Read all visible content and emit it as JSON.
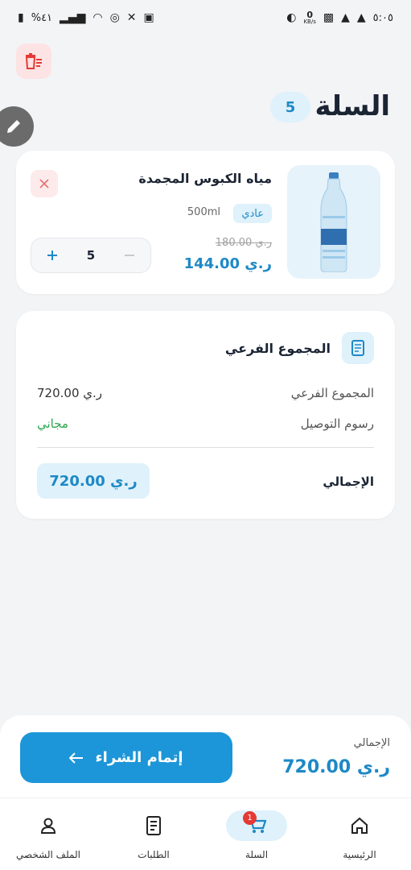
{
  "status_bar": {
    "time": "٥:٠٥",
    "speed_value": "0",
    "speed_unit": "KB/s",
    "battery": "%٤١"
  },
  "header": {
    "title": "السلة",
    "count": "5"
  },
  "cart_item": {
    "name": "مياه الكبوس المجمدة",
    "type_tag": "عادي",
    "size": "500ml",
    "old_price": "180.00 ر.ي",
    "new_price": "144.00 ر.ي",
    "quantity": "5"
  },
  "summary": {
    "title": "المجموع الفرعي",
    "subtotal_label": "المجموع الفرعي",
    "subtotal_value": "720.00 ر.ي",
    "delivery_label": "رسوم التوصيل",
    "delivery_value": "مجاني",
    "total_label": "الإجمالي",
    "total_value": "720.00 ر.ي"
  },
  "checkout": {
    "label": "الإجمالي",
    "total": "720.00 ر.ي",
    "button": "إتمام الشراء"
  },
  "nav": {
    "home": "الرئيسية",
    "cart": "السلة",
    "cart_badge": "1",
    "orders": "الطلبات",
    "profile": "الملف الشخصي"
  },
  "colors": {
    "accent": "#1c96d8",
    "accent_light": "#dff1fb",
    "danger_light": "#fde3e3",
    "success": "#2ea64e",
    "background": "#f3f4f6"
  }
}
